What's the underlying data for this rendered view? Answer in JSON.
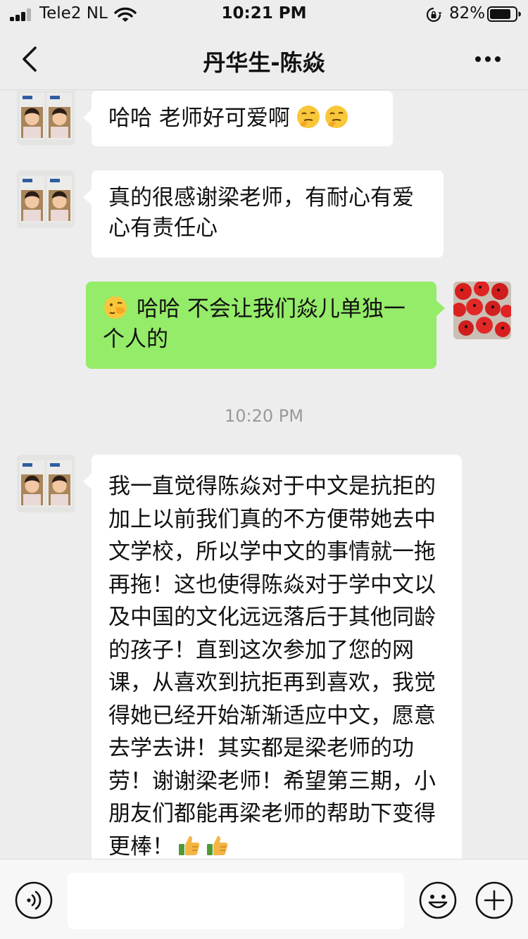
{
  "status_bar": {
    "carrier": "Tele2 NL",
    "time": "10:21 PM",
    "battery": "82%",
    "battery_level": 0.82,
    "signal_bars": 3
  },
  "nav": {
    "title": "丹华生-陈焱"
  },
  "messages": [
    {
      "sender": "contact",
      "text": "哈哈  老师好可爱啊",
      "emojis": [
        "thinking-face-emoji",
        "thinking-face-emoji"
      ]
    },
    {
      "sender": "contact",
      "text": "真的很感谢梁老师，有耐心有爱心有责任心"
    },
    {
      "sender": "me",
      "leading_emoji": "face-with-hand-emoji",
      "text": "哈哈 不会让我们焱儿单独一个人的"
    },
    {
      "sender": "contact",
      "text": "我一直觉得陈焱对于中文是抗拒的加上以前我们真的不方便带她去中文学校，所以学中文的事情就一拖再拖！这也使得陈焱对于学中文以及中国的文化远远落后于其他同龄的孩子！直到这次参加了您的网课，从喜欢到抗拒再到喜欢，我觉得她已经开始渐渐适应中文，愿意去学去讲！其实都是梁老师的功劳！谢谢梁老师！希望第三期，小朋友们都能再梁老师的帮助下变得更棒！",
      "emojis": [
        "thumbs-up-emoji",
        "thumbs-up-emoji"
      ]
    }
  ],
  "timestamp": "10:20 PM",
  "input": {
    "value": "",
    "placeholder": ""
  },
  "colors": {
    "background": "#ededed",
    "bubble_in": "#ffffff",
    "bubble_out": "#95ec69",
    "timestamp": "#999999"
  }
}
